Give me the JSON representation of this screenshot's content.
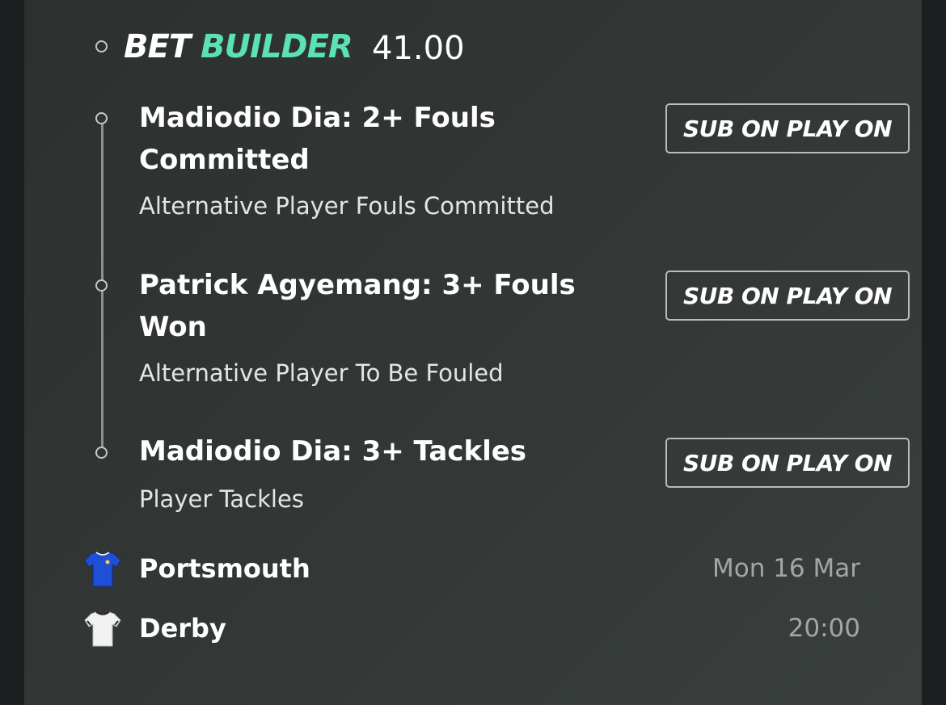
{
  "header": {
    "title_part1": "BET",
    "title_part2": "BUILDER",
    "odds": "41.00",
    "accent_color": "#5ce1b5"
  },
  "selections": [
    {
      "title": "Madiodio Dia: 2+ Fouls Committed",
      "market": "Alternative Player Fouls Committed",
      "button_label": "SUB ON PLAY ON"
    },
    {
      "title": "Patrick Agyemang: 3+ Fouls Won",
      "market": "Alternative Player To Be Fouled",
      "button_label": "SUB ON PLAY ON"
    },
    {
      "title": "Madiodio Dia: 3+ Tackles",
      "market": "Player Tackles",
      "button_label": "SUB ON PLAY ON"
    }
  ],
  "match": {
    "home": {
      "name": "Portsmouth",
      "kit_icon": "blue-shirt-icon",
      "kit_color": "#1f4fd6"
    },
    "away": {
      "name": "Derby",
      "kit_icon": "white-shirt-icon",
      "kit_color": "#f2f2f2"
    },
    "date": "Mon 16 Mar",
    "time": "20:00"
  }
}
